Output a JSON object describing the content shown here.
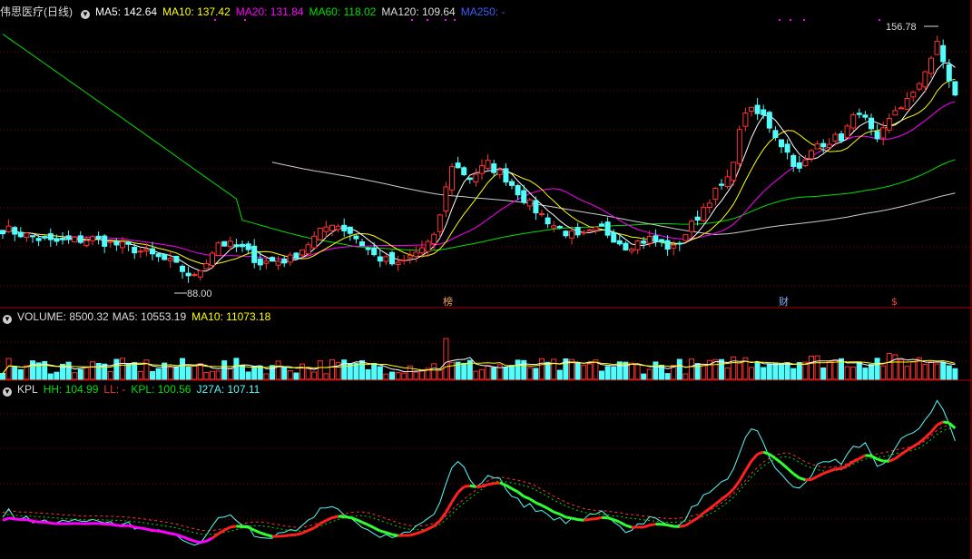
{
  "price_legend": {
    "title": "伟思医疗(日线)",
    "ma5": "MA5: 142.64",
    "ma10": "MA10: 137.42",
    "ma20": "MA20: 131.84",
    "ma60": "MA60: 118.02",
    "ma120": "MA120: 109.64",
    "ma250": "MA250: -"
  },
  "volume_legend": {
    "volume": "VOLUME: 8500.32",
    "ma5": "MA5: 10553.19",
    "ma10": "MA10: 11073.18"
  },
  "kpl_legend": {
    "name": "KPL",
    "hh": "HH: 104.99",
    "ll": "LL: -",
    "kpl": "KPL: 100.56",
    "j27a": "J27A: 107.11"
  },
  "annotations": {
    "high": "156.78",
    "low": "88.00",
    "tag1": "榜",
    "tag2": "财",
    "tag3": "$"
  },
  "colors": {
    "up": "#ff3232",
    "down": "#54fcfc",
    "ma5": "#ffffff",
    "ma10": "#ffff00",
    "ma20": "#ff00ff",
    "ma60": "#00e000",
    "ma120": "#cccccc",
    "ma250": "#3c5cff",
    "grid": "#8b0000"
  },
  "chart_data": {
    "type": "candlestick",
    "bars": 160,
    "price_anchors": [
      [
        0,
        103
      ],
      [
        8,
        99
      ],
      [
        15,
        100
      ],
      [
        22,
        97
      ],
      [
        28,
        93
      ],
      [
        32,
        88.5
      ],
      [
        36,
        99
      ],
      [
        40,
        97
      ],
      [
        43,
        93
      ],
      [
        48,
        94
      ],
      [
        55,
        105
      ],
      [
        58,
        102
      ],
      [
        62,
        95
      ],
      [
        66,
        92
      ],
      [
        72,
        100
      ],
      [
        75,
        122
      ],
      [
        78,
        118
      ],
      [
        81,
        122
      ],
      [
        84,
        118
      ],
      [
        88,
        110
      ],
      [
        92,
        104
      ],
      [
        96,
        100
      ],
      [
        100,
        103
      ],
      [
        104,
        98
      ],
      [
        108,
        100
      ],
      [
        112,
        97
      ],
      [
        115,
        104
      ],
      [
        118,
        112
      ],
      [
        121,
        117
      ],
      [
        124,
        138
      ],
      [
        127,
        136
      ],
      [
        130,
        128
      ],
      [
        133,
        120
      ],
      [
        136,
        128
      ],
      [
        140,
        130
      ],
      [
        143,
        138
      ],
      [
        146,
        128
      ],
      [
        149,
        138
      ],
      [
        152,
        142
      ],
      [
        154,
        150
      ],
      [
        156,
        157
      ],
      [
        159,
        142
      ]
    ],
    "high": 156.78,
    "low": 88.0,
    "ma_values": {
      "MA5": 142.64,
      "MA10": 137.42,
      "MA20": 131.84,
      "MA60": 118.02,
      "MA120": 109.64
    },
    "volume_last": 8500.32,
    "kpl": {
      "HH": 104.99,
      "KPL": 100.56,
      "J27A": 107.11
    }
  }
}
